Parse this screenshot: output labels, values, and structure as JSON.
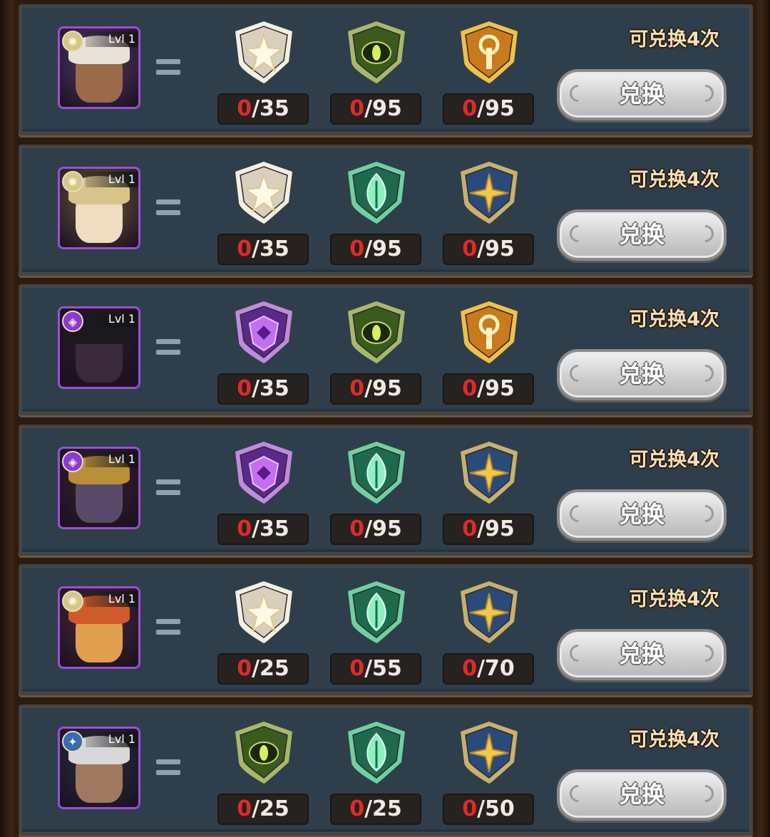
{
  "rows": [
    {
      "hero_level": "Lvl 1",
      "hero_faction_icon": "celestial-sun-icon",
      "hero_colors": {
        "bg": "#5a3a6a",
        "hair": "#e8e2d8",
        "face": "#9a6a4a"
      },
      "items": [
        {
          "icon": "celestial-star-shield-icon",
          "have": "0",
          "need": "/35"
        },
        {
          "icon": "green-eye-shield-icon",
          "have": "0",
          "need": "/95"
        },
        {
          "icon": "gold-tower-shield-icon",
          "have": "0",
          "need": "/95"
        }
      ],
      "limit_text": "可兑换4次",
      "button_label": "兑换"
    },
    {
      "hero_level": "Lvl 1",
      "hero_faction_icon": "celestial-sun-icon",
      "hero_colors": {
        "bg": "#6a5a3a",
        "hair": "#d8c48a",
        "face": "#f0dcc0"
      },
      "items": [
        {
          "icon": "celestial-star-shield-icon",
          "have": "0",
          "need": "/35"
        },
        {
          "icon": "green-leaf-shield-icon",
          "have": "0",
          "need": "/95"
        },
        {
          "icon": "blue-star-shield-icon",
          "have": "0",
          "need": "/95"
        }
      ],
      "limit_text": "可兑换4次",
      "button_label": "兑换"
    },
    {
      "hero_level": "Lvl 1",
      "hero_faction_icon": "hypogean-icon",
      "hero_colors": {
        "bg": "#2a1a2a",
        "hair": "#1a1a1e",
        "face": "#3a2a3a"
      },
      "items": [
        {
          "icon": "purple-mask-shield-icon",
          "have": "0",
          "need": "/35"
        },
        {
          "icon": "green-eye-shield-icon",
          "have": "0",
          "need": "/95"
        },
        {
          "icon": "gold-tower-shield-icon",
          "have": "0",
          "need": "/95"
        }
      ],
      "limit_text": "可兑换4次",
      "button_label": "兑换"
    },
    {
      "hero_level": "Lvl 1",
      "hero_faction_icon": "hypogean-icon",
      "hero_colors": {
        "bg": "#3a2030",
        "hair": "#b8903a",
        "face": "#5a4a6a"
      },
      "items": [
        {
          "icon": "purple-mask-shield-icon",
          "have": "0",
          "need": "/35"
        },
        {
          "icon": "green-leaf-shield-icon",
          "have": "0",
          "need": "/95"
        },
        {
          "icon": "blue-star-shield-icon",
          "have": "0",
          "need": "/95"
        }
      ],
      "limit_text": "可兑换4次",
      "button_label": "兑换"
    },
    {
      "hero_level": "Lvl 1",
      "hero_faction_icon": "celestial-sun-icon",
      "hero_colors": {
        "bg": "#4a2a3a",
        "hair": "#d05a2a",
        "face": "#e0a050"
      },
      "items": [
        {
          "icon": "celestial-star-shield-icon",
          "have": "0",
          "need": "/25"
        },
        {
          "icon": "green-leaf-shield-icon",
          "have": "0",
          "need": "/55"
        },
        {
          "icon": "blue-star-shield-icon",
          "have": "0",
          "need": "/70"
        }
      ],
      "limit_text": "可兑换4次",
      "button_label": "兑换"
    },
    {
      "hero_level": "Lvl 1",
      "hero_faction_icon": "dimensional-star-icon",
      "hero_colors": {
        "bg": "#2a3040",
        "hair": "#d8d8d8",
        "face": "#a07860"
      },
      "items": [
        {
          "icon": "green-eye-shield-icon",
          "have": "0",
          "need": "/25"
        },
        {
          "icon": "green-leaf-shield-icon",
          "have": "0",
          "need": "/25"
        },
        {
          "icon": "blue-star-shield-icon",
          "have": "0",
          "need": "/50"
        }
      ],
      "limit_text": "可兑换4次",
      "button_label": "兑换"
    }
  ],
  "colors": {
    "panel": "#2f3e4b",
    "count_have": "#e02a2a",
    "limit_text": "#f3dfb8",
    "avatar_border": "#9b4fd6"
  }
}
